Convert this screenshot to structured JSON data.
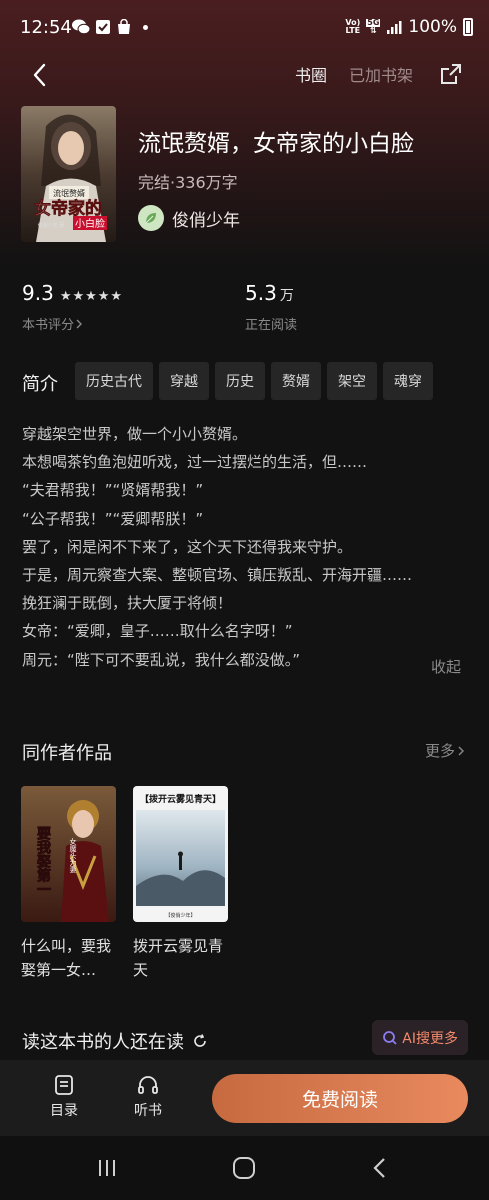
{
  "status_bar": {
    "time": "12:54",
    "net_top": "Vo)",
    "net_bottom": "LTE",
    "net_5g": "5G",
    "battery": "100%"
  },
  "nav": {
    "circle": "书圈",
    "added": "已加书架"
  },
  "book": {
    "title": "流氓赘婿，女帝家的小白脸",
    "meta": "完结·336万字",
    "author": "俊俏少年",
    "cover_text": {
      "top": "流氓赘婿",
      "main": "女帝家的",
      "sub": "小白脸",
      "author": "俊俏少年 著"
    }
  },
  "stats": {
    "score": "9.3",
    "stars": "★★★★★",
    "score_label": "本书评分",
    "readers": "5.3",
    "readers_unit": "万",
    "readers_label": "正在阅读"
  },
  "intro": {
    "heading": "简介",
    "tags": [
      "历史古代",
      "穿越",
      "历史",
      "赘婿",
      "架空",
      "魂穿"
    ],
    "lines": [
      "穿越架空世界，做一个小小赘婿。",
      "本想喝茶钓鱼泡妞听戏，过一过摆烂的生活，但……",
      "“夫君帮我！”“贤婿帮我！”",
      "“公子帮我！”“爱卿帮朕！”",
      "罢了，闲是闲不下来了，这个天下还得我来守护。",
      "于是，周元察查大案、整顿官场、镇压叛乱、开海开疆……",
      "挽狂澜于既倒，扶大厦于将倾！",
      "女帝：“爱卿，皇子……取什么名字呀！”",
      "周元：“陛下可不要乱说，我什么都没做。”"
    ],
    "collapse": "收起"
  },
  "same_author": {
    "title": "同作者作品",
    "more": "更多",
    "works": [
      {
        "title": "什么叫，要我娶第一女…",
        "cover_main": "要我娶第一",
        "cover_side": "女魔头为妻"
      },
      {
        "title": "拨开云雾见青天",
        "cover_main": "【拨开云雾见青天】",
        "cover_side": "【俊俏少年】"
      }
    ]
  },
  "also_reading": {
    "title": "读这本书的人还在读",
    "ai_label": "AI搜更多"
  },
  "bottom": {
    "toc": "目录",
    "listen": "听书",
    "read": "免费阅读"
  },
  "colors": {
    "accent": "#e07a4f",
    "background": "#121212"
  }
}
